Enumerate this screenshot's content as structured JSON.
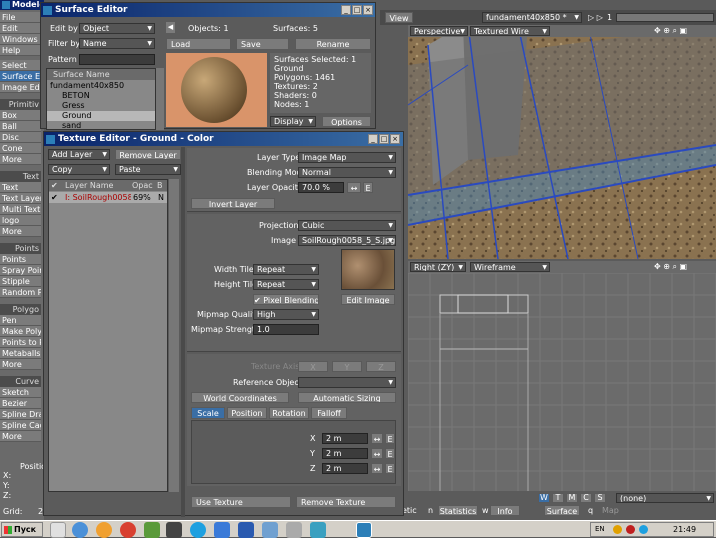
{
  "modeler": {
    "title": "Modeler",
    "menu": [
      "File",
      "Edit",
      "Windows",
      "Help"
    ],
    "sections": [
      {
        "header": "",
        "items": [
          "Select",
          "Surface Ed",
          "Image Edit"
        ]
      },
      {
        "header": "Primitiv",
        "items": [
          "Box",
          "Ball",
          "Disc",
          "Cone",
          "More"
        ]
      },
      {
        "header": "Text",
        "items": [
          "Text",
          "Text Layer",
          "Multi Text",
          "logo",
          "More"
        ]
      },
      {
        "header": "Points",
        "items": [
          "Points",
          "Spray Poin",
          "Stipple",
          "Random P"
        ]
      },
      {
        "header": "Polygo",
        "items": [
          "Pen",
          "Make Poly",
          "Points to P",
          "Metaballs",
          "More"
        ]
      },
      {
        "header": "Curve",
        "items": [
          "Sketch",
          "Bezier",
          "Spline Dra",
          "Spline Cag",
          "More"
        ]
      }
    ],
    "position_label": "Positio",
    "axes": [
      "X:",
      "Y:",
      "Z:"
    ],
    "grid_label": "Grid:",
    "grid_value": "2"
  },
  "surface_editor": {
    "title": "Surface Editor",
    "edit_by_label": "Edit by",
    "edit_by_value": "Object",
    "filter_by_label": "Filter by",
    "filter_by_value": "Name",
    "pattern_label": "Pattern",
    "objects": "Objects: 1",
    "surfaces": "Surfaces: 5",
    "load": "Load",
    "save": "Save",
    "rename": "Rename",
    "list_header": "Surface Name",
    "tree": [
      "fundament40x850",
      "BETON",
      "Gress",
      "Ground",
      "sand"
    ],
    "selected_index": 3,
    "info": [
      "Surfaces Selected: 1",
      "Ground",
      "Polygons: 1461",
      "Textures: 2",
      "Shaders: 0",
      "Nodes: 1"
    ],
    "display": "Display",
    "options": "Options"
  },
  "texture_editor": {
    "title": "Texture Editor - Ground - Color",
    "add_layer": "Add Layer",
    "remove_layer": "Remove Layer",
    "copy": "Copy",
    "paste": "Paste",
    "columns": [
      "Layer Name",
      "Opac",
      "B"
    ],
    "layer": {
      "name": "I: SoilRough0058...",
      "opacity": "69%",
      "blend": "N"
    },
    "layer_type_label": "Layer Type",
    "layer_type": "Image Map",
    "blending_mode_label": "Blending Mode",
    "blending_mode": "Normal",
    "layer_opacity_label": "Layer Opacity",
    "layer_opacity": "70.0 %",
    "invert_layer": "Invert Layer",
    "projection_label": "Projection",
    "projection": "Cubic",
    "image_label": "Image",
    "image": "SoilRough0058_5_S.jpg",
    "width_tile_label": "Width Tile",
    "width_tile": "Repeat",
    "height_tile_label": "Height Tile",
    "height_tile": "Repeat",
    "pixel_blending": "Pixel Blending",
    "edit_image": "Edit Image",
    "mipmap_quality_label": "Mipmap Quality",
    "mipmap_quality": "High",
    "mipmap_strength_label": "Mipmap Strength",
    "mipmap_strength": "1.0",
    "texture_axis_label": "Texture Axis",
    "axes": [
      "X",
      "Y",
      "Z"
    ],
    "reference_object_label": "Reference Object",
    "reference_object": "",
    "world_coordinates": "World Coordinates",
    "automatic_sizing": "Automatic Sizing",
    "tabs": [
      "Scale",
      "Position",
      "Rotation",
      "Falloff"
    ],
    "scale": [
      {
        "axis": "X",
        "value": "2 m"
      },
      {
        "axis": "Y",
        "value": "2 m"
      },
      {
        "axis": "Z",
        "value": "2 m"
      }
    ],
    "use_texture": "Use Texture",
    "remove_texture": "Remove Texture",
    "e_btn": "E"
  },
  "viewport": {
    "view_btn": "View",
    "object_name": "fundament40x850 *",
    "layer_nums": [
      "1"
    ],
    "top_view": "Perspective",
    "top_mode": "Textured Wire",
    "bottom_view": "Right",
    "bottom_axis": "(ZY)",
    "bottom_mode": "Wireframe",
    "wtmcs": [
      "W",
      "T",
      "M",
      "C",
      "S"
    ],
    "none_sel": "(none)",
    "status_tabs": [
      "etic",
      "Statistics",
      "Info",
      "Surface"
    ],
    "status_fields": [
      "n",
      "w",
      "",
      "q",
      "Map"
    ]
  },
  "taskbar": {
    "start": "Пуск",
    "clock": "21:49",
    "lang": "EN"
  }
}
